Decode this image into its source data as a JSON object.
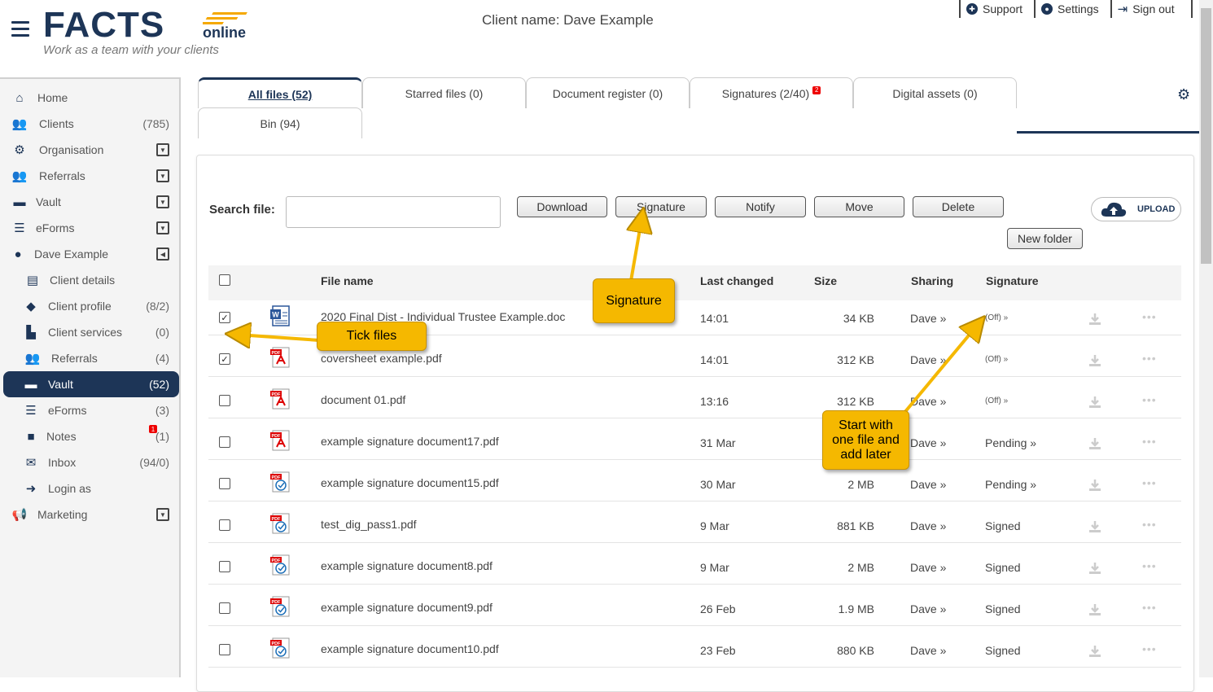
{
  "header": {
    "logo_main": "FACTS",
    "logo_online": "online",
    "logo_tagline": "Work as a team with your clients",
    "client_name": "Client name: Dave Example",
    "links": [
      {
        "label": "Support",
        "icon": "support-icon"
      },
      {
        "label": "Settings",
        "icon": "user-icon"
      },
      {
        "label": "Sign out",
        "icon": "sign-out-icon"
      }
    ]
  },
  "sidebar": {
    "items": [
      {
        "label": "Home",
        "icon": "home-icon",
        "count": ""
      },
      {
        "label": "Clients",
        "icon": "users-icon",
        "count": "(785)"
      },
      {
        "label": "Organisation",
        "icon": "org-icon",
        "count": ""
      },
      {
        "label": "Referrals",
        "icon": "referrals-icon",
        "count": ""
      },
      {
        "label": "Vault",
        "icon": "vault-icon",
        "count": ""
      },
      {
        "label": "eForms",
        "icon": "list-icon",
        "count": ""
      },
      {
        "label": "Dave Example",
        "icon": "user-icon",
        "count": ""
      },
      {
        "label": "Client details",
        "icon": "id-card-icon",
        "count": ""
      },
      {
        "label": "Client profile",
        "icon": "tag-icon",
        "count": "(8/2)"
      },
      {
        "label": "Client services",
        "icon": "chart-icon",
        "count": "(0)"
      },
      {
        "label": "Referrals",
        "icon": "referrals-icon",
        "count": "(4)"
      },
      {
        "label": "Vault",
        "icon": "vault-icon",
        "count": "(52)"
      },
      {
        "label": "eForms",
        "icon": "list-icon",
        "count": "(3)"
      },
      {
        "label": "Notes",
        "icon": "note-icon",
        "count": "(1)",
        "badge": "1"
      },
      {
        "label": "Inbox",
        "icon": "envelope-icon",
        "count": "(94/0)"
      },
      {
        "label": "Login as",
        "icon": "login-icon",
        "count": ""
      },
      {
        "label": "Marketing",
        "icon": "megaphone-icon",
        "count": ""
      }
    ]
  },
  "tabs": [
    {
      "label": "All files (52)",
      "active": true
    },
    {
      "label": "Starred files (0)"
    },
    {
      "label": "Document register (0)"
    },
    {
      "label": "Signatures (2/40)",
      "badge": "2"
    },
    {
      "label": "Digital assets (0)"
    },
    {
      "label": "Bin (94)"
    }
  ],
  "toolbar": {
    "search_label": "Search file:",
    "search_value": "",
    "download": "Download",
    "signature": "Signature",
    "notify": "Notify",
    "move": "Move",
    "delete": "Delete",
    "upload": "UPLOAD",
    "new_folder": "New folder"
  },
  "table": {
    "columns": {
      "name": "File name",
      "changed": "Last changed",
      "size": "Size",
      "sharing": "Sharing",
      "signature": "Signature"
    },
    "rows": [
      {
        "checked": true,
        "type": "word",
        "name": "2020 Final Dist - Individual Trustee Example.doc",
        "changed": "14:01",
        "size": "34 KB",
        "sharing": "Dave »",
        "signature": "(Off) »",
        "sig_off": true
      },
      {
        "checked": true,
        "type": "pdf",
        "name": "coversheet example.pdf",
        "changed": "14:01",
        "size": "312 KB",
        "sharing": "Dave »",
        "signature": "(Off) »",
        "sig_off": true
      },
      {
        "checked": false,
        "type": "pdf",
        "name": "document 01.pdf",
        "changed": "13:16",
        "size": "312 KB",
        "sharing": "Dave »",
        "signature": "(Off) »",
        "sig_off": true
      },
      {
        "checked": false,
        "type": "pdf",
        "name": "example signature document17.pdf",
        "changed": "31 Mar",
        "size": "",
        "sharing": "Dave »",
        "signature": "Pending »"
      },
      {
        "checked": false,
        "type": "pdf-signed",
        "name": "example signature document15.pdf",
        "changed": "30 Mar",
        "size": "2 MB",
        "sharing": "Dave »",
        "signature": "Pending »"
      },
      {
        "checked": false,
        "type": "pdf-signed",
        "name": "test_dig_pass1.pdf",
        "changed": "9 Mar",
        "size": "881 KB",
        "sharing": "Dave »",
        "signature": "Signed"
      },
      {
        "checked": false,
        "type": "pdf-signed",
        "name": "example signature document8.pdf",
        "changed": "9 Mar",
        "size": "2 MB",
        "sharing": "Dave »",
        "signature": "Signed"
      },
      {
        "checked": false,
        "type": "pdf-signed",
        "name": "example signature document9.pdf",
        "changed": "26 Feb",
        "size": "1.9 MB",
        "sharing": "Dave »",
        "signature": "Signed"
      },
      {
        "checked": false,
        "type": "pdf-signed",
        "name": "example signature document10.pdf",
        "changed": "23 Feb",
        "size": "880 KB",
        "sharing": "Dave »",
        "signature": "Signed"
      }
    ]
  },
  "callouts": {
    "signature": "Signature",
    "tick_files": "Tick files",
    "start_with": "Start with one file and add later"
  },
  "colors": {
    "brand": "#1d3557",
    "accent": "#f5b800",
    "badge": "#e00000"
  }
}
